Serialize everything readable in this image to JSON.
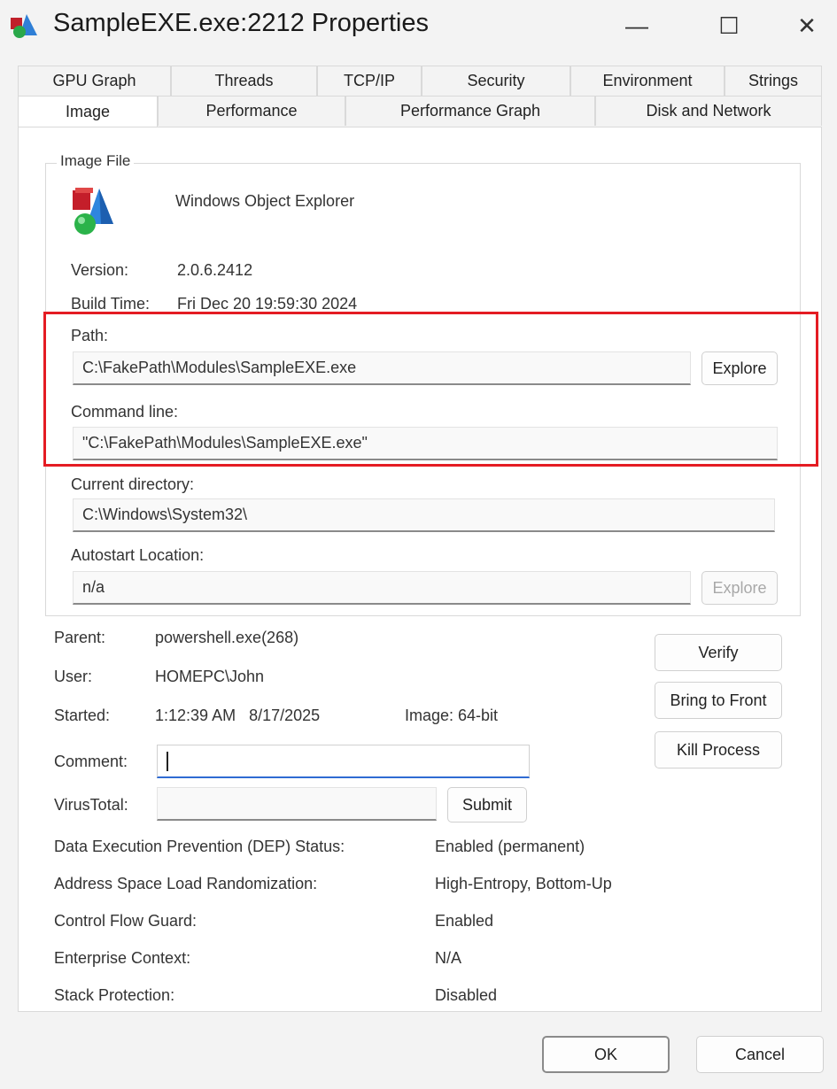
{
  "window": {
    "title": "SampleEXE.exe:2212 Properties",
    "controls": {
      "minimize": "—",
      "maximize": "☐",
      "close": "✕"
    }
  },
  "tabs": {
    "row1": [
      "GPU Graph",
      "Threads",
      "TCP/IP",
      "Security",
      "Environment",
      "Strings"
    ],
    "row2": [
      "Image",
      "Performance",
      "Performance Graph",
      "Disk and Network"
    ],
    "active": "Image"
  },
  "image_file": {
    "group_label": "Image File",
    "description": "Windows Object Explorer",
    "version_label": "Version:",
    "version_value": "2.0.6.2412",
    "build_label": "Build Time:",
    "build_value": "Fri Dec 20 19:59:30 2024",
    "path_label": "Path:",
    "path_value": "C:\\FakePath\\Modules\\SampleEXE.exe",
    "explore_label": "Explore",
    "cmd_label": "Command line:",
    "cmd_value": "\"C:\\FakePath\\Modules\\SampleEXE.exe\"",
    "cwd_label": "Current directory:",
    "cwd_value": "C:\\Windows\\System32\\",
    "autostart_label": "Autostart Location:",
    "autostart_value": "n/a",
    "autostart_explore_label": "Explore"
  },
  "process": {
    "parent_label": "Parent:",
    "parent_value": "powershell.exe(268)",
    "user_label": "User:",
    "user_value": "HOMEPC\\John",
    "started_label": "Started:",
    "started_value": "1:12:39 AM   8/17/2025",
    "image_label": "Image: 64-bit",
    "comment_label": "Comment:",
    "virustotal_label": "VirusTotal:",
    "submit_label": "Submit",
    "verify_label": "Verify",
    "bring_front_label": "Bring to Front",
    "kill_label": "Kill Process"
  },
  "security_props": [
    {
      "label": "Data Execution Prevention (DEP) Status:",
      "value": "Enabled (permanent)"
    },
    {
      "label": "Address Space Load Randomization:",
      "value": "High-Entropy, Bottom-Up"
    },
    {
      "label": "Control Flow Guard:",
      "value": "Enabled"
    },
    {
      "label": "Enterprise Context:",
      "value": "N/A"
    },
    {
      "label": "Stack Protection:",
      "value": "Disabled"
    }
  ],
  "footer": {
    "ok_label": "OK",
    "cancel_label": "Cancel"
  },
  "colors": {
    "highlight": "#e41c23",
    "focus": "#2f6bd3",
    "panel": "#ffffff",
    "window_bg": "#f3f3f3"
  }
}
